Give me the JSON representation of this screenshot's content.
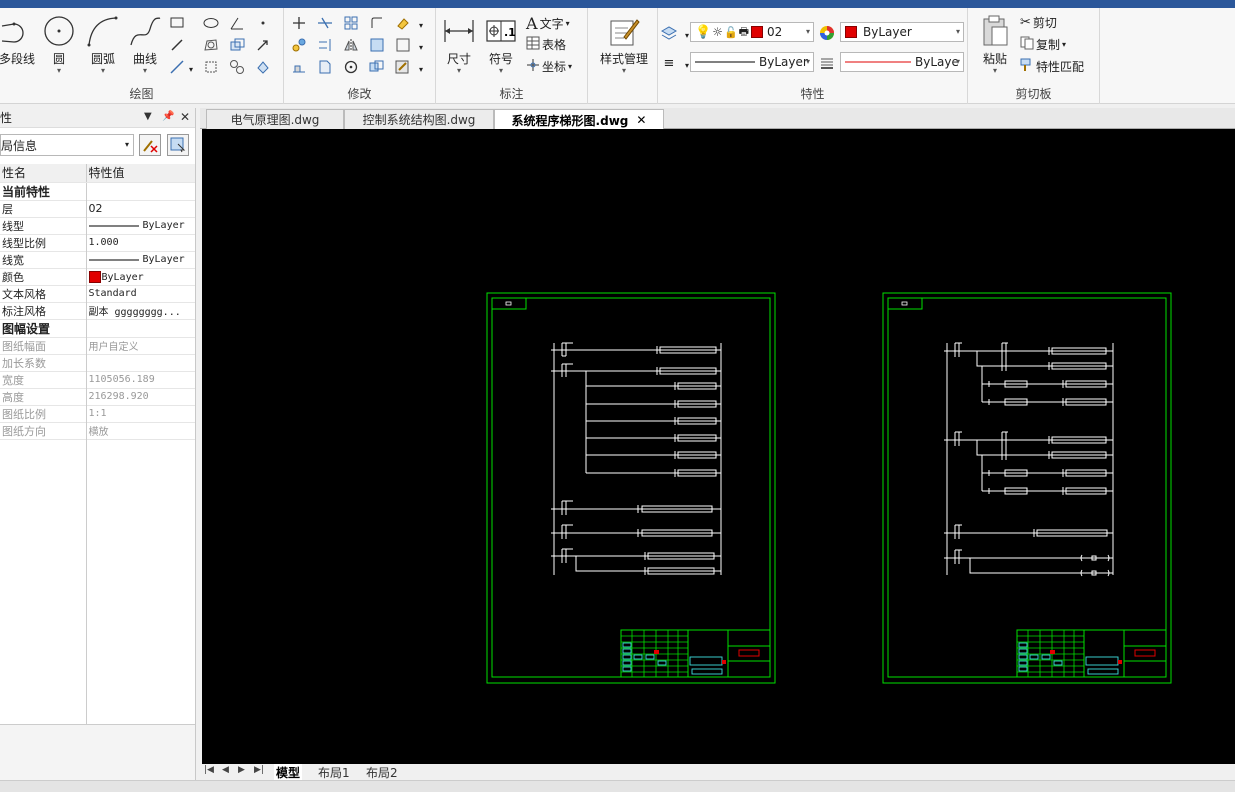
{
  "ribbon": {
    "draw": {
      "label": "绘图",
      "polyline": "多段线",
      "circle": "圆",
      "arc": "圆弧",
      "curve": "曲线"
    },
    "modify": {
      "label": "修改"
    },
    "annotate": {
      "label": "标注",
      "dimension": "尺寸",
      "symbol": "符号",
      "text": "文字",
      "table": "表格",
      "coord": "坐标"
    },
    "style": {
      "label": "样式管理"
    },
    "properties": {
      "label": "特性",
      "layer_value": "02",
      "color_value": "ByLayer",
      "linetype_value": "ByLayer",
      "lineweight_value": "ByLaye"
    },
    "clipboard": {
      "label": "剪切板",
      "paste": "粘贴",
      "cut": "剪切",
      "copy": "复制",
      "match": "特性匹配"
    }
  },
  "panel": {
    "title": "性",
    "selector": "局信息",
    "col_name": "性名",
    "col_value": "特性值",
    "rows": [
      {
        "k": "当前特性",
        "v": "",
        "type": "cat"
      },
      {
        "k": "层",
        "v": "02",
        "type": "row"
      },
      {
        "k": "线型",
        "v": "ByLayer",
        "type": "line"
      },
      {
        "k": "线型比例",
        "v": "1.000",
        "type": "mono"
      },
      {
        "k": "线宽",
        "v": "ByLayer",
        "type": "line"
      },
      {
        "k": "颜色",
        "v": "ByLayer",
        "type": "color"
      },
      {
        "k": "文本风格",
        "v": "Standard",
        "type": "mono"
      },
      {
        "k": "标注风格",
        "v": "副本 gggggggg...",
        "type": "mono"
      },
      {
        "k": "图幅设置",
        "v": "",
        "type": "cat"
      },
      {
        "k": "图纸幅面",
        "v": "用户自定义",
        "type": "dis"
      },
      {
        "k": "加长系数",
        "v": "",
        "type": "dis"
      },
      {
        "k": "宽度",
        "v": "1105056.189",
        "type": "dis"
      },
      {
        "k": "高度",
        "v": "216298.920",
        "type": "dis"
      },
      {
        "k": "图纸比例",
        "v": "1:1",
        "type": "dis"
      },
      {
        "k": "图纸方向",
        "v": "横放",
        "type": "dis"
      }
    ]
  },
  "doc_tabs": [
    {
      "label": "电气原理图.dwg",
      "active": false
    },
    {
      "label": "控制系统结构图.dwg",
      "active": false
    },
    {
      "label": "系统程序梯形图.dwg",
      "active": true
    }
  ],
  "layout_tabs": [
    "模型",
    "布局1",
    "布局2"
  ],
  "colors": {
    "accent": "#2b579a",
    "frame": "#00e000",
    "canvas": "#000000",
    "drawing": "#ffffff",
    "layer_red": "#e00000"
  }
}
